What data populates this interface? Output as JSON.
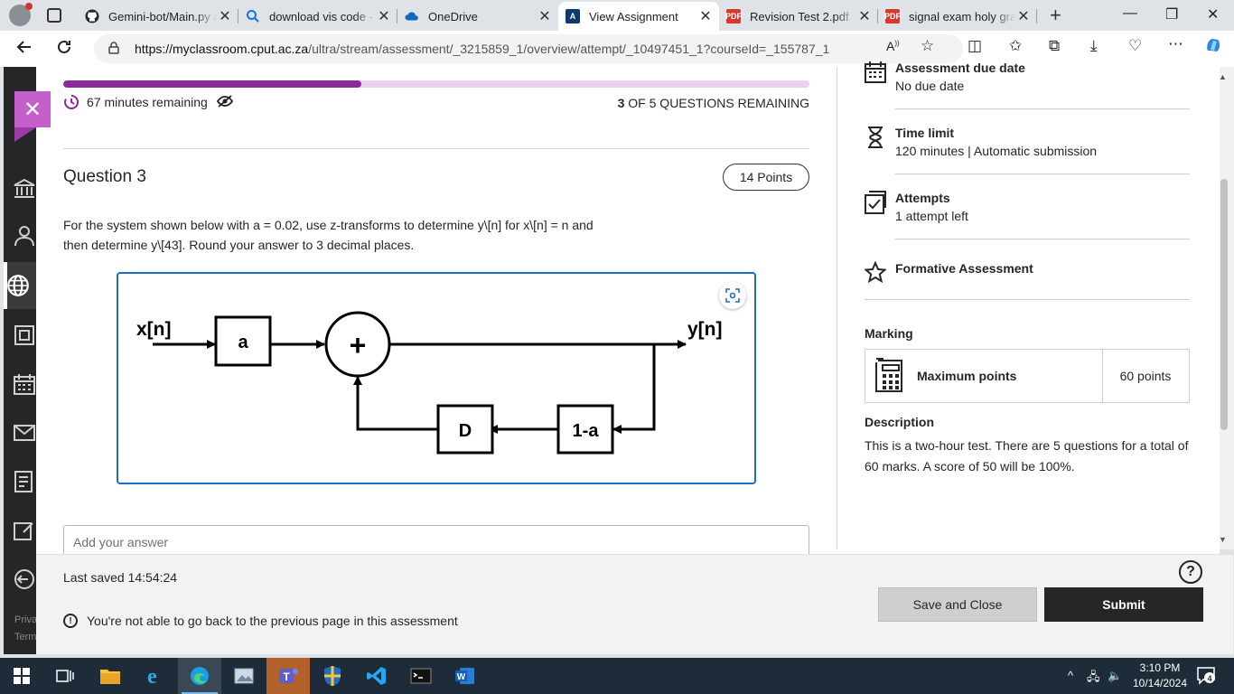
{
  "browser": {
    "tabs": [
      {
        "title": "Gemini-bot/Main.py at",
        "icon": "github-icon",
        "active": false
      },
      {
        "title": "download vis code - Se",
        "icon": "search-icon",
        "active": false
      },
      {
        "title": "OneDrive",
        "icon": "onedrive-icon",
        "active": false
      },
      {
        "title": "View Assignment",
        "icon": "blackboard-icon",
        "active": true
      },
      {
        "title": "Revision Test 2.pdf",
        "icon": "pdf-icon",
        "active": false
      },
      {
        "title": "signal exam holy grail",
        "icon": "pdf-icon",
        "active": false
      }
    ],
    "url_host": "https://myclassroom.cput.ac.za",
    "url_path": "/ultra/stream/assessment/_3215859_1/overview/attempt/_10497451_1?courseId=_155787_1"
  },
  "assessment": {
    "progress_fraction": 0.4,
    "time_remaining": "67 minutes remaining",
    "questions_remaining_count": "3",
    "questions_remaining_text": " OF 5 QUESTIONS REMAINING",
    "question_title": "Question 3",
    "points_badge": "14 Points",
    "question_text": "For the system shown below with a = 0.02, use z-transforms to determine y\\[n] for x\\[n] = n and then determine y\\[43]. Round your answer to 3 decimal places.",
    "diagram": {
      "input_label": "x[n]",
      "output_label": "y[n]",
      "gain_block": "a",
      "sum_symbol": "+",
      "delay_block": "D",
      "feedback_block": "1-a"
    },
    "answer_placeholder": "Add your answer"
  },
  "details": {
    "due_title": "Assessment due date",
    "due_value": "No due date",
    "time_title": "Time limit",
    "time_value": "120 minutes | Automatic submission",
    "attempts_title": "Attempts",
    "attempts_value": "1 attempt left",
    "formative_title": "Formative Assessment",
    "marking_title": "Marking",
    "max_points_label": "Maximum points",
    "max_points_value": "60 points",
    "description_title": "Description",
    "description_text": "This is a two-hour test. There are 5 questions for a total of 60 marks. A score of 50 will be 100%."
  },
  "footer": {
    "last_saved": "Last saved 14:54:24",
    "warning": "You're not able to go back to the previous page in this assessment",
    "save_close": "Save and Close",
    "submit": "Submit"
  },
  "rail_footer": {
    "privacy": "Priva",
    "terms": "Term"
  },
  "taskbar": {
    "time": "3:10 PM",
    "date": "10/14/2024",
    "notifications": "4"
  },
  "colors": {
    "accent": "#8c2a9c",
    "accent_light": "#ecd0f0",
    "close_button": "#c55fcc",
    "figure_border": "#1f6fbf"
  }
}
